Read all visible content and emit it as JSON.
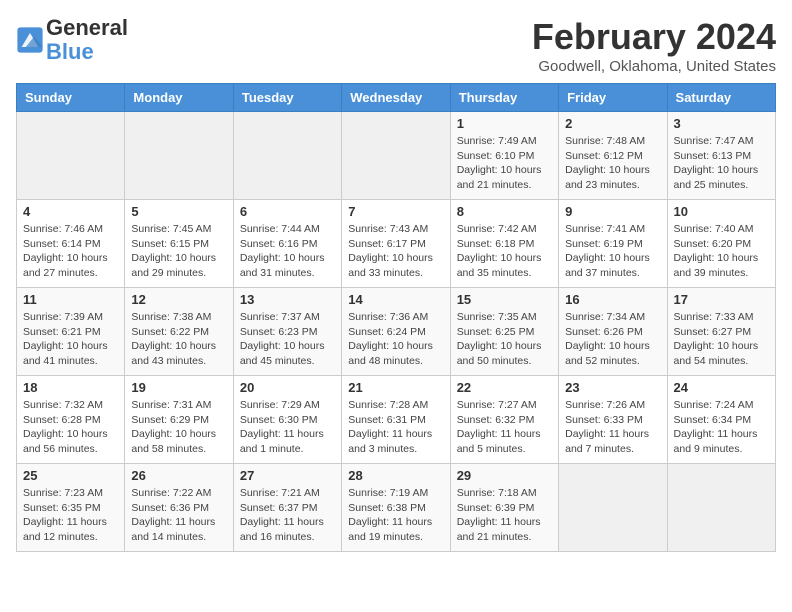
{
  "header": {
    "logo_line1": "General",
    "logo_line2": "Blue",
    "month_title": "February 2024",
    "location": "Goodwell, Oklahoma, United States"
  },
  "weekdays": [
    "Sunday",
    "Monday",
    "Tuesday",
    "Wednesday",
    "Thursday",
    "Friday",
    "Saturday"
  ],
  "weeks": [
    [
      {
        "day": "",
        "info": ""
      },
      {
        "day": "",
        "info": ""
      },
      {
        "day": "",
        "info": ""
      },
      {
        "day": "",
        "info": ""
      },
      {
        "day": "1",
        "info": "Sunrise: 7:49 AM\nSunset: 6:10 PM\nDaylight: 10 hours\nand 21 minutes."
      },
      {
        "day": "2",
        "info": "Sunrise: 7:48 AM\nSunset: 6:12 PM\nDaylight: 10 hours\nand 23 minutes."
      },
      {
        "day": "3",
        "info": "Sunrise: 7:47 AM\nSunset: 6:13 PM\nDaylight: 10 hours\nand 25 minutes."
      }
    ],
    [
      {
        "day": "4",
        "info": "Sunrise: 7:46 AM\nSunset: 6:14 PM\nDaylight: 10 hours\nand 27 minutes."
      },
      {
        "day": "5",
        "info": "Sunrise: 7:45 AM\nSunset: 6:15 PM\nDaylight: 10 hours\nand 29 minutes."
      },
      {
        "day": "6",
        "info": "Sunrise: 7:44 AM\nSunset: 6:16 PM\nDaylight: 10 hours\nand 31 minutes."
      },
      {
        "day": "7",
        "info": "Sunrise: 7:43 AM\nSunset: 6:17 PM\nDaylight: 10 hours\nand 33 minutes."
      },
      {
        "day": "8",
        "info": "Sunrise: 7:42 AM\nSunset: 6:18 PM\nDaylight: 10 hours\nand 35 minutes."
      },
      {
        "day": "9",
        "info": "Sunrise: 7:41 AM\nSunset: 6:19 PM\nDaylight: 10 hours\nand 37 minutes."
      },
      {
        "day": "10",
        "info": "Sunrise: 7:40 AM\nSunset: 6:20 PM\nDaylight: 10 hours\nand 39 minutes."
      }
    ],
    [
      {
        "day": "11",
        "info": "Sunrise: 7:39 AM\nSunset: 6:21 PM\nDaylight: 10 hours\nand 41 minutes."
      },
      {
        "day": "12",
        "info": "Sunrise: 7:38 AM\nSunset: 6:22 PM\nDaylight: 10 hours\nand 43 minutes."
      },
      {
        "day": "13",
        "info": "Sunrise: 7:37 AM\nSunset: 6:23 PM\nDaylight: 10 hours\nand 45 minutes."
      },
      {
        "day": "14",
        "info": "Sunrise: 7:36 AM\nSunset: 6:24 PM\nDaylight: 10 hours\nand 48 minutes."
      },
      {
        "day": "15",
        "info": "Sunrise: 7:35 AM\nSunset: 6:25 PM\nDaylight: 10 hours\nand 50 minutes."
      },
      {
        "day": "16",
        "info": "Sunrise: 7:34 AM\nSunset: 6:26 PM\nDaylight: 10 hours\nand 52 minutes."
      },
      {
        "day": "17",
        "info": "Sunrise: 7:33 AM\nSunset: 6:27 PM\nDaylight: 10 hours\nand 54 minutes."
      }
    ],
    [
      {
        "day": "18",
        "info": "Sunrise: 7:32 AM\nSunset: 6:28 PM\nDaylight: 10 hours\nand 56 minutes."
      },
      {
        "day": "19",
        "info": "Sunrise: 7:31 AM\nSunset: 6:29 PM\nDaylight: 10 hours\nand 58 minutes."
      },
      {
        "day": "20",
        "info": "Sunrise: 7:29 AM\nSunset: 6:30 PM\nDaylight: 11 hours\nand 1 minute."
      },
      {
        "day": "21",
        "info": "Sunrise: 7:28 AM\nSunset: 6:31 PM\nDaylight: 11 hours\nand 3 minutes."
      },
      {
        "day": "22",
        "info": "Sunrise: 7:27 AM\nSunset: 6:32 PM\nDaylight: 11 hours\nand 5 minutes."
      },
      {
        "day": "23",
        "info": "Sunrise: 7:26 AM\nSunset: 6:33 PM\nDaylight: 11 hours\nand 7 minutes."
      },
      {
        "day": "24",
        "info": "Sunrise: 7:24 AM\nSunset: 6:34 PM\nDaylight: 11 hours\nand 9 minutes."
      }
    ],
    [
      {
        "day": "25",
        "info": "Sunrise: 7:23 AM\nSunset: 6:35 PM\nDaylight: 11 hours\nand 12 minutes."
      },
      {
        "day": "26",
        "info": "Sunrise: 7:22 AM\nSunset: 6:36 PM\nDaylight: 11 hours\nand 14 minutes."
      },
      {
        "day": "27",
        "info": "Sunrise: 7:21 AM\nSunset: 6:37 PM\nDaylight: 11 hours\nand 16 minutes."
      },
      {
        "day": "28",
        "info": "Sunrise: 7:19 AM\nSunset: 6:38 PM\nDaylight: 11 hours\nand 19 minutes."
      },
      {
        "day": "29",
        "info": "Sunrise: 7:18 AM\nSunset: 6:39 PM\nDaylight: 11 hours\nand 21 minutes."
      },
      {
        "day": "",
        "info": ""
      },
      {
        "day": "",
        "info": ""
      }
    ]
  ]
}
